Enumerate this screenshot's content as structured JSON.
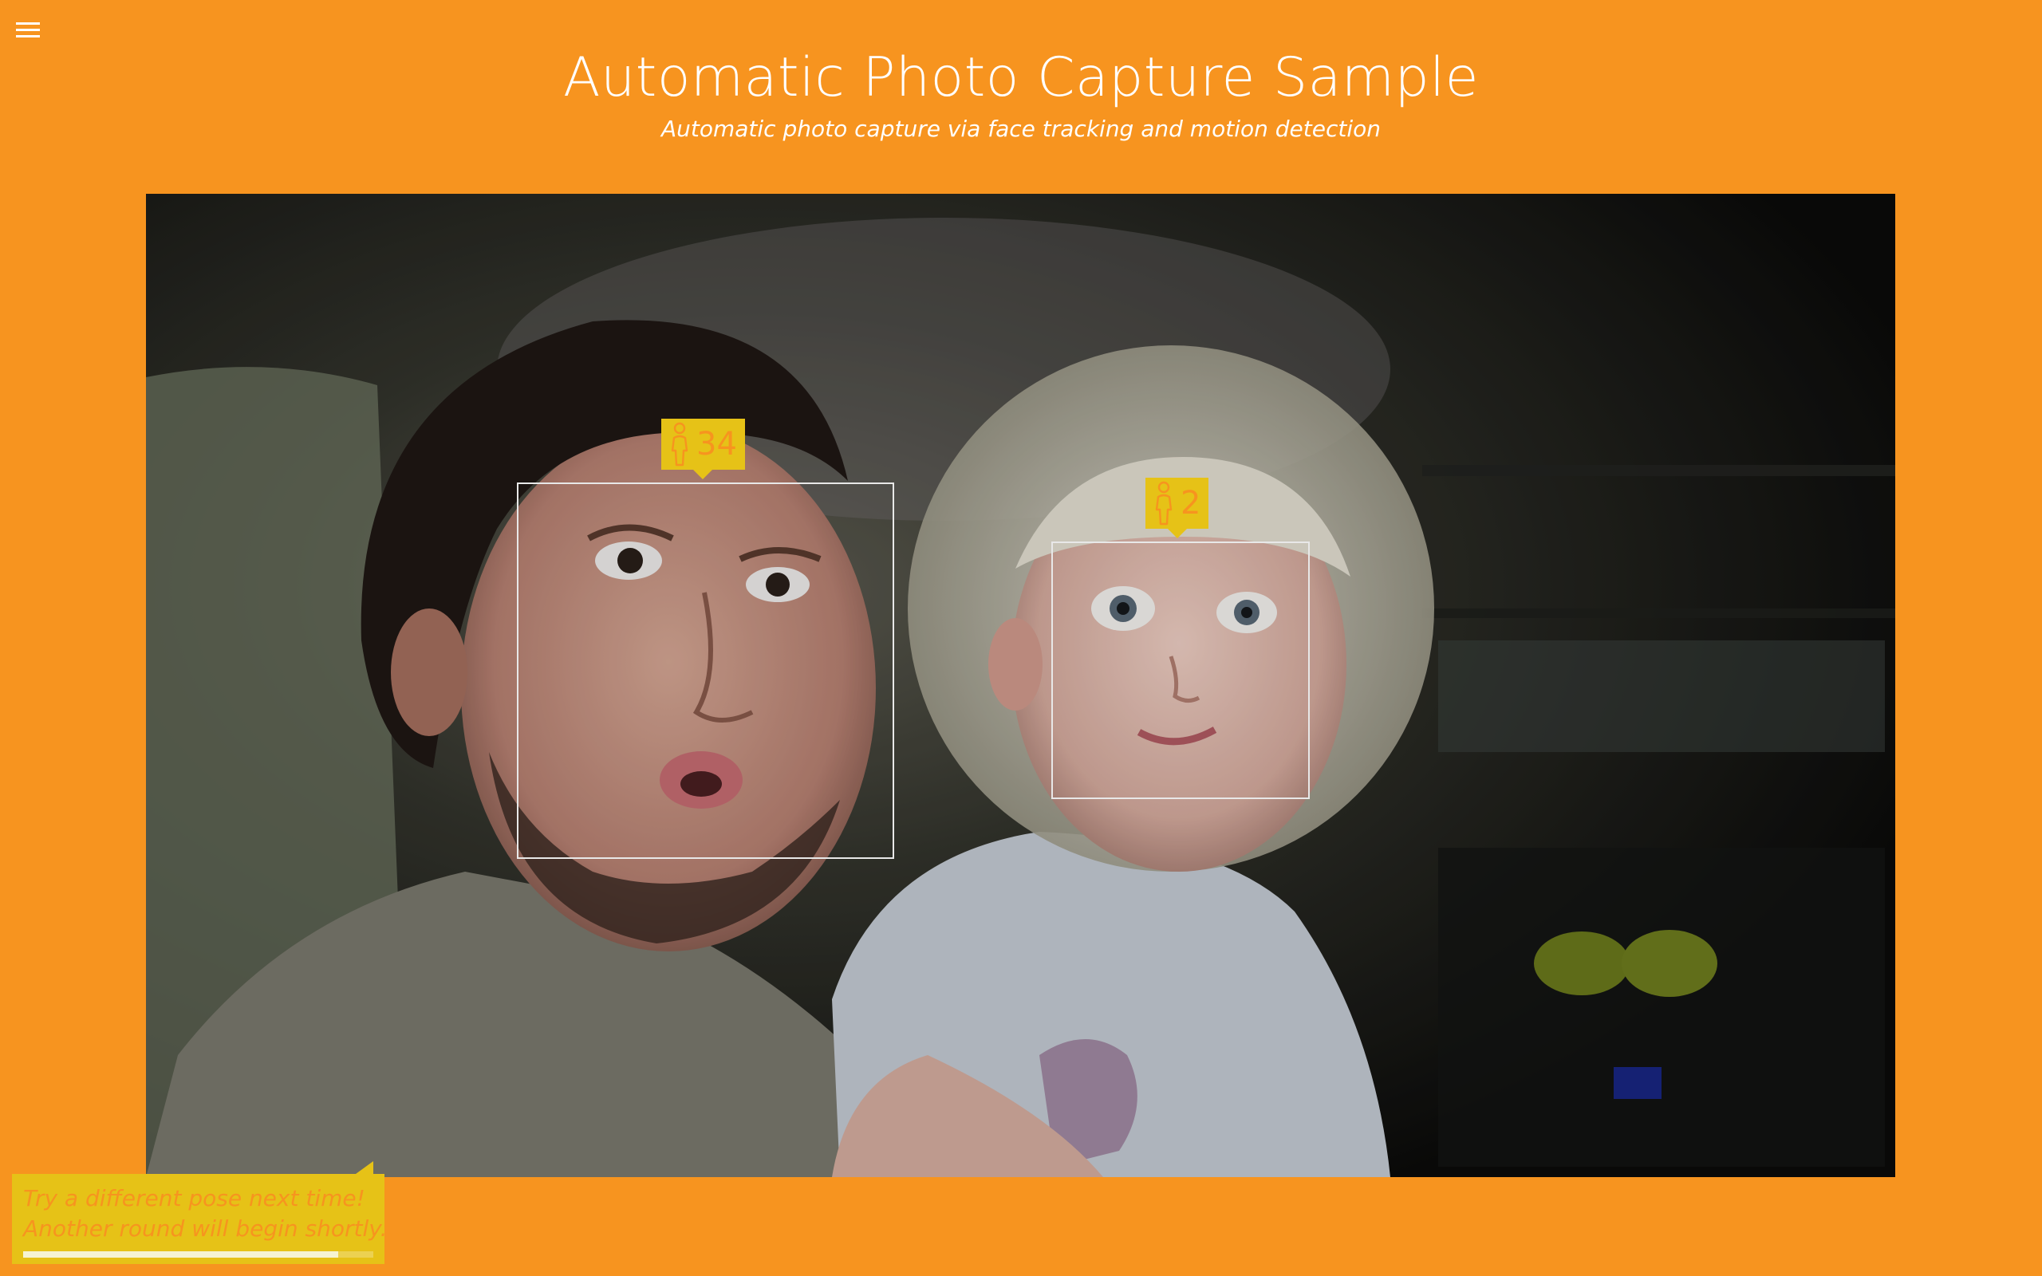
{
  "app": {
    "title": "Automatic Photo Capture Sample",
    "subtitle": "Automatic photo capture via face tracking and motion detection"
  },
  "colors": {
    "background": "#F7941F",
    "tag_background": "#E6C217",
    "tag_text": "#F7941F",
    "box_border": "#e8e8e8"
  },
  "menu": {
    "icon": "hamburger-icon"
  },
  "faces": [
    {
      "age": "34",
      "icon": "person-icon"
    },
    {
      "age": "2",
      "icon": "person-icon"
    }
  ],
  "toast": {
    "line1": "Try a different pose next time!",
    "line2": "Another round will begin shortly...",
    "progress": 0.9
  }
}
